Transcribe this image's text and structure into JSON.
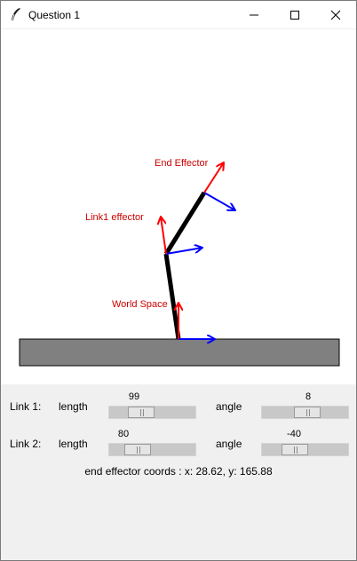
{
  "window": {
    "title": "Question 1",
    "accent": "#ffffff"
  },
  "canvas": {
    "labels": {
      "end_effector": "End Effector",
      "link1_effector": "Link1 effector",
      "world_space": "World Space"
    },
    "colors": {
      "x_axis": "#0000ff",
      "y_axis": "#ff0000",
      "link": "#000000",
      "ground": "#808080",
      "label": "#cc0000"
    }
  },
  "controls": {
    "link1": {
      "label": "Link 1:",
      "length_label": "length",
      "length_value": "99",
      "length_fraction": 0.32,
      "angle_label": "angle",
      "angle_value": "8",
      "angle_fraction": 0.53
    },
    "link2": {
      "label": "Link 2:",
      "length_label": "length",
      "length_value": "80",
      "length_fraction": 0.25,
      "angle_label": "angle",
      "angle_value": "-40",
      "angle_fraction": 0.33
    },
    "coords_text": "end effector coords : x: 28.62, y: 165.88"
  }
}
